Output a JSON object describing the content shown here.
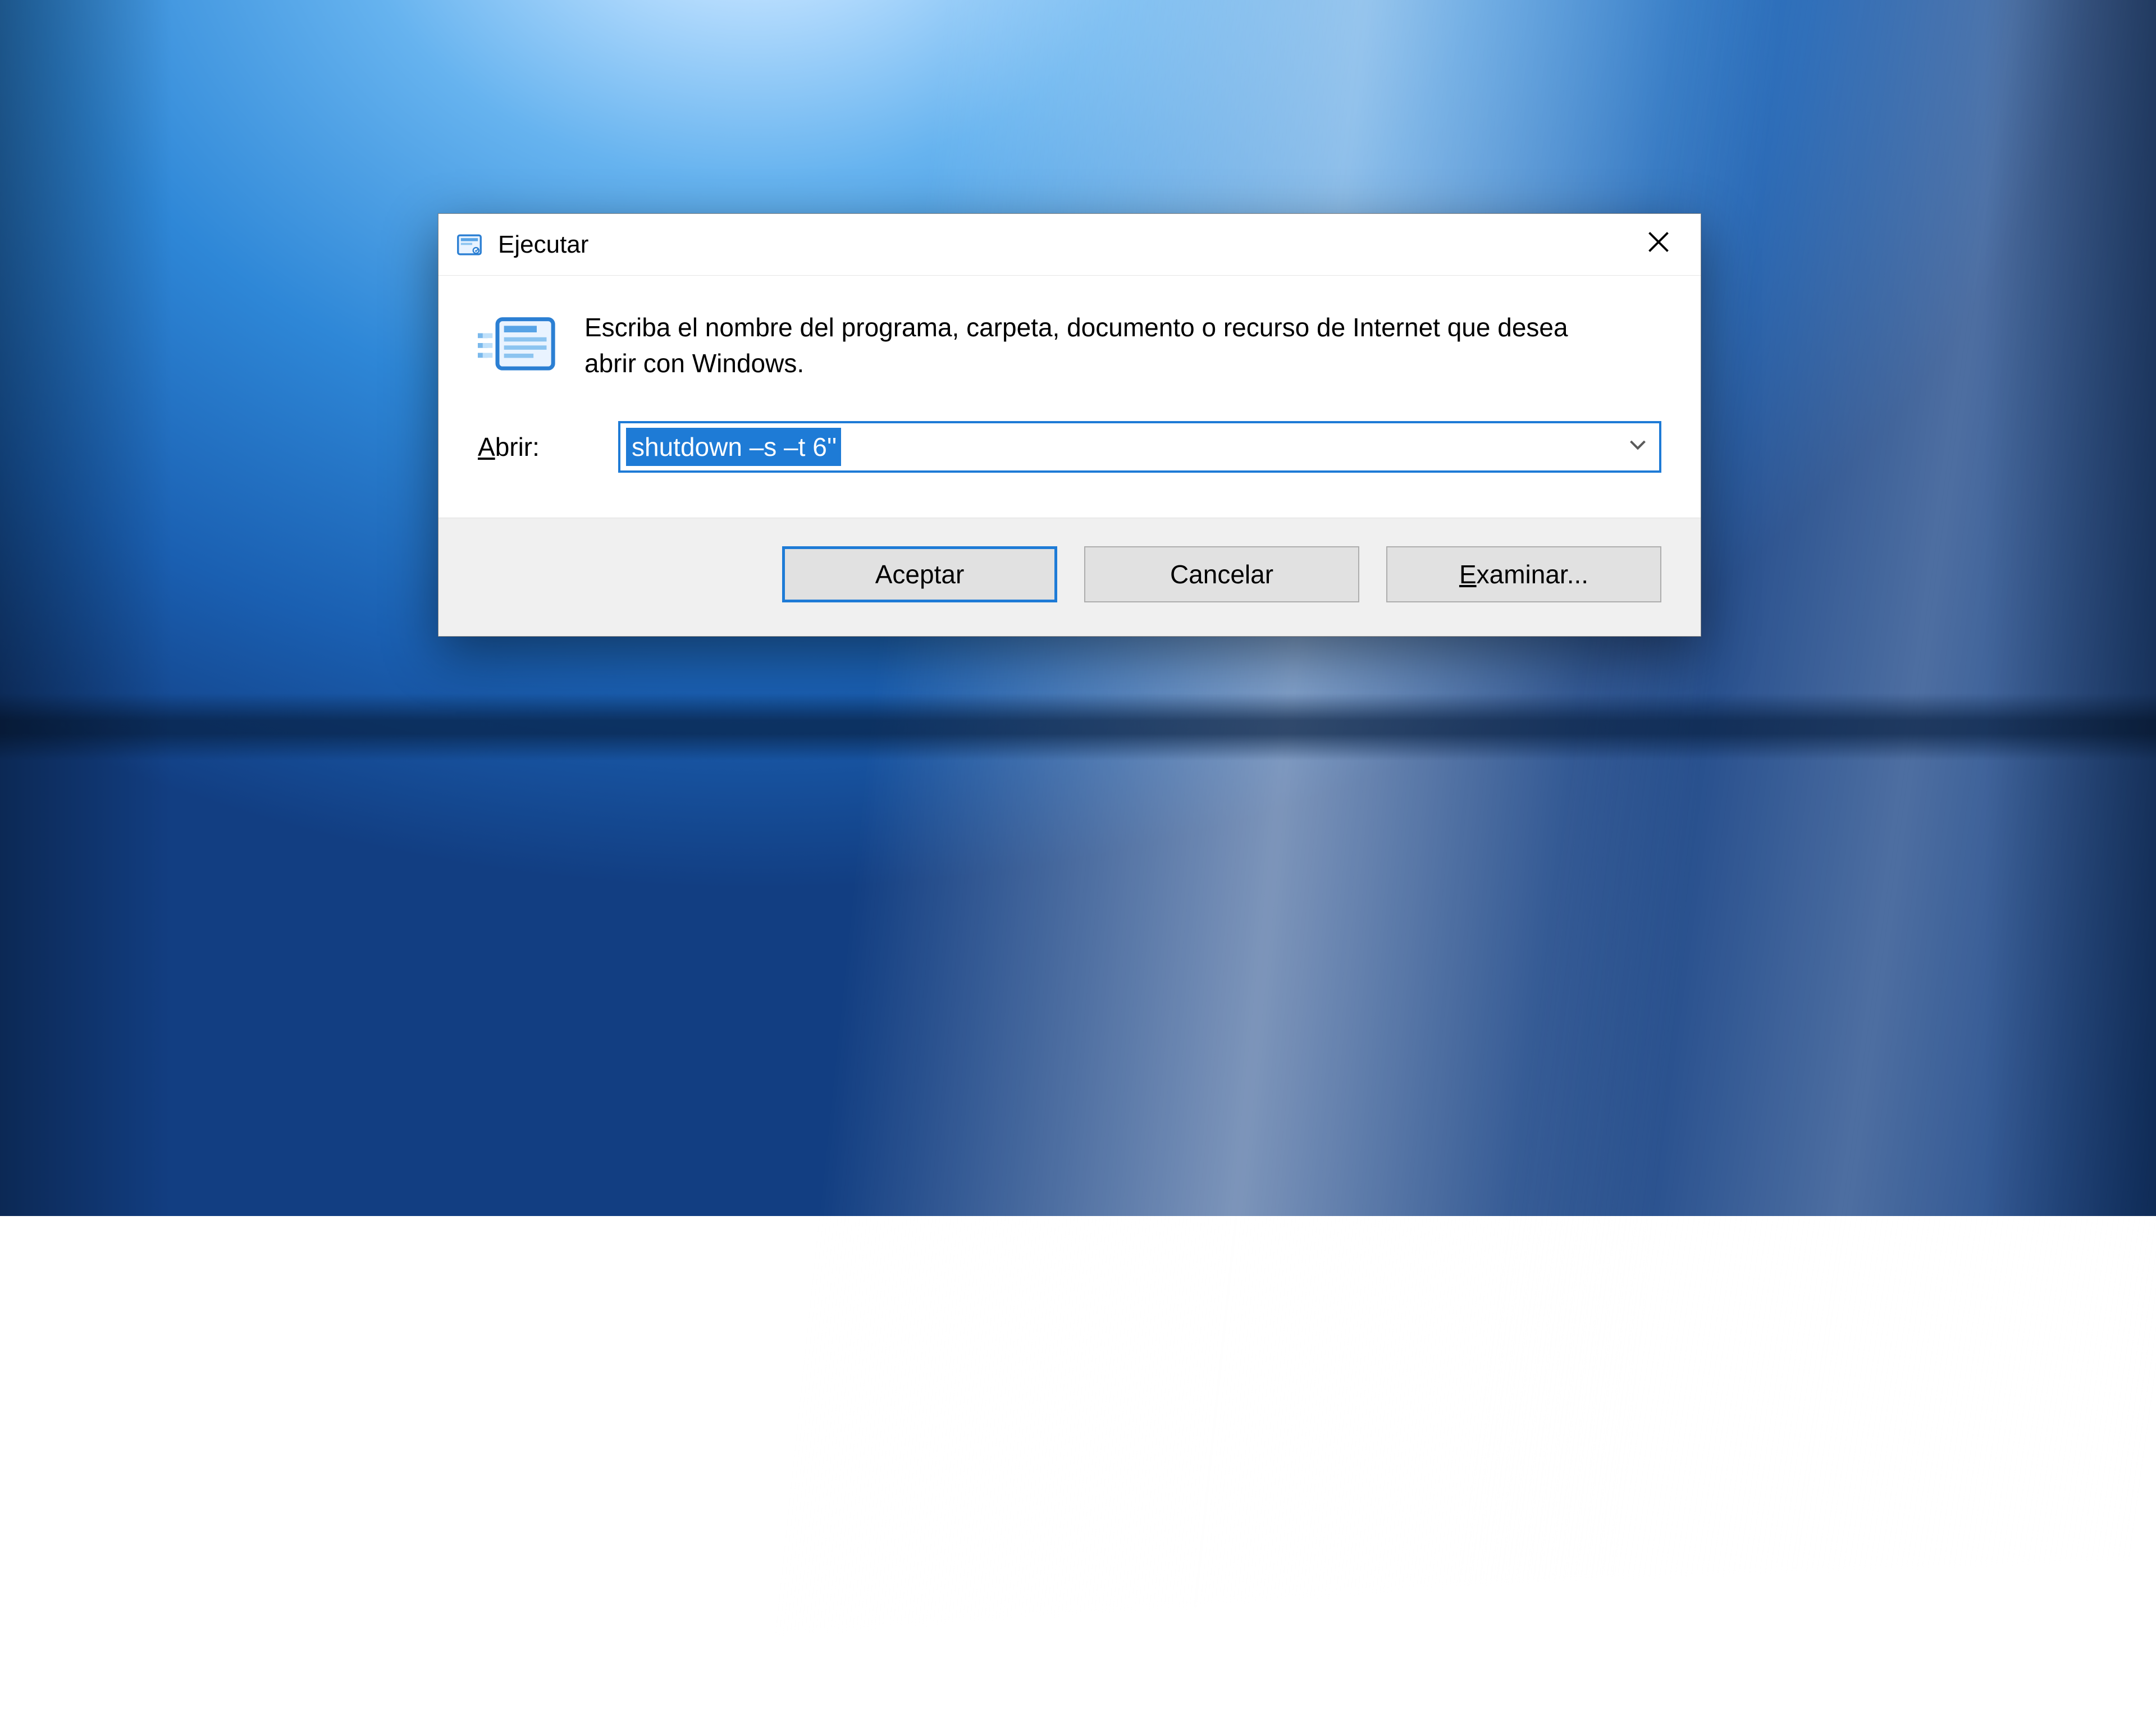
{
  "window": {
    "title": "Ejecutar",
    "icon_name": "run-icon"
  },
  "body": {
    "description": "Escriba el nombre del programa, carpeta, documento o recurso de Internet que desea abrir con Windows.",
    "open_label_prefix": "A",
    "open_label_rest": "brir:",
    "command_value": "shutdown –s –t 6''"
  },
  "buttons": {
    "ok": "Aceptar",
    "cancel": "Cancelar",
    "browse_accel": "E",
    "browse_rest": "xaminar..."
  }
}
